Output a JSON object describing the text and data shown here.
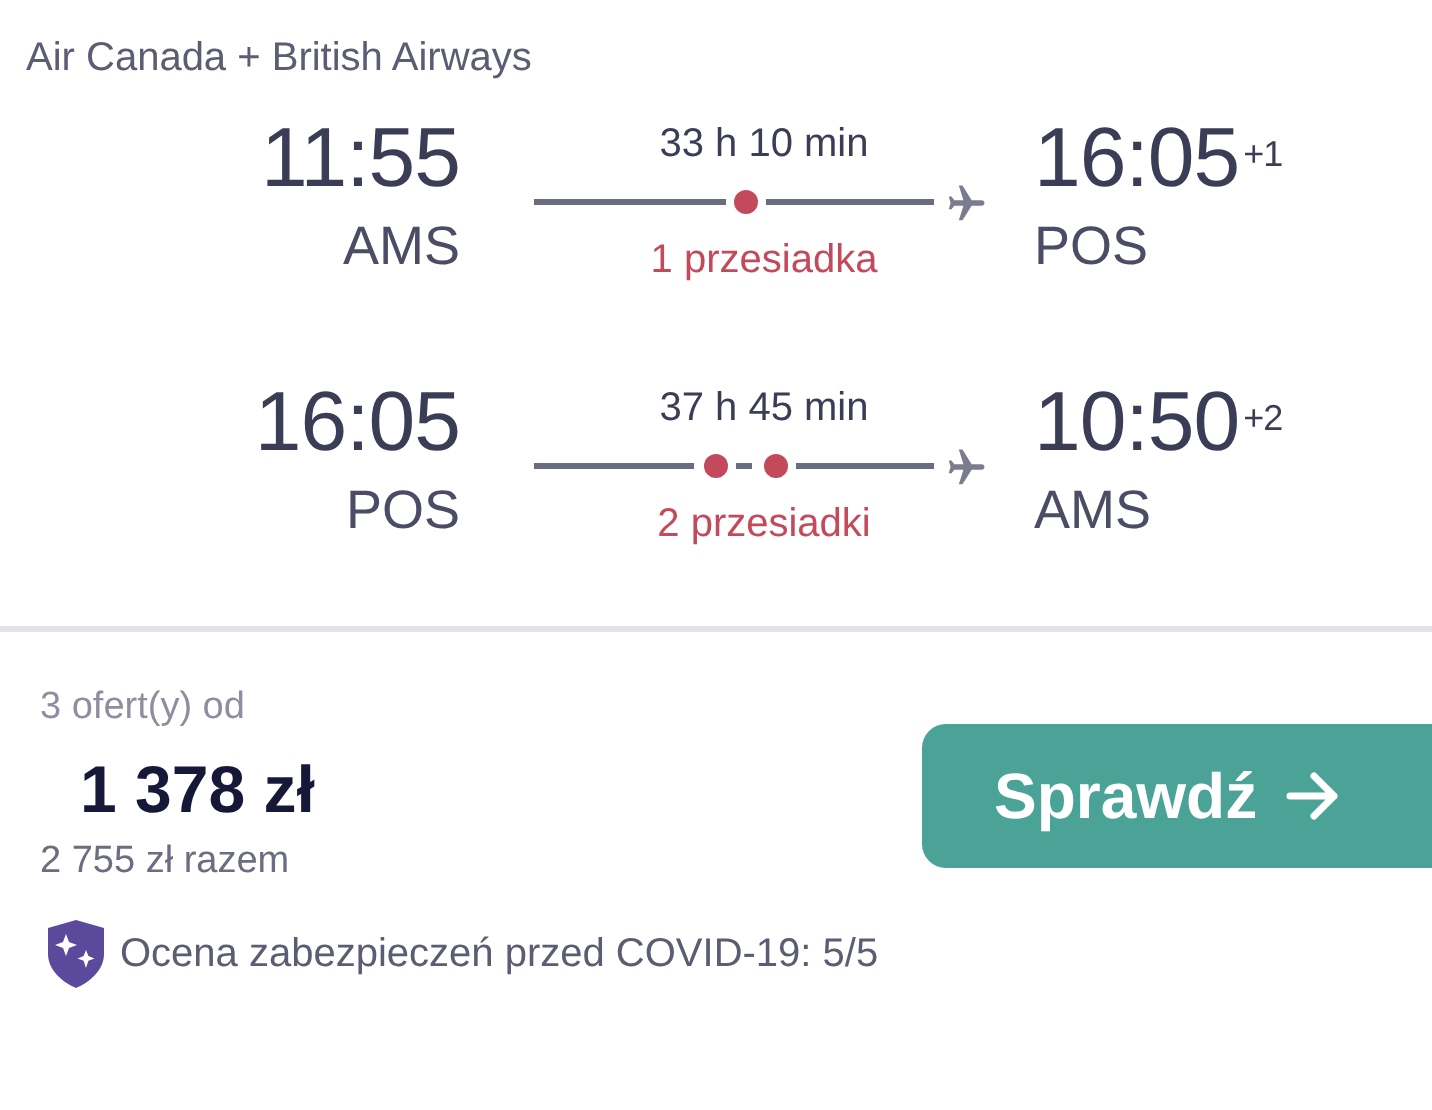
{
  "airlines": "Air Canada + British Airways",
  "legs": [
    {
      "departure_time": "11:55",
      "departure_airport": "AMS",
      "duration": "33 h 10 min",
      "kind": "one-stop",
      "stops_label": "1 przesiadka",
      "arrival_time": "16:05",
      "day_offset": "+1",
      "arrival_airport": "POS"
    },
    {
      "departure_time": "16:05",
      "departure_airport": "POS",
      "duration": "37 h 45 min",
      "kind": "two-stop",
      "stops_label": "2 przesiadki",
      "arrival_time": "10:50",
      "day_offset": "+2",
      "arrival_airport": "AMS"
    }
  ],
  "offers": "3 ofert(y) od",
  "price": "1 378 zł",
  "total": "2 755 zł razem",
  "button": "Sprawdź",
  "covid_rating": "Ocena zabezpieczeń przed COVID-19: 5/5"
}
